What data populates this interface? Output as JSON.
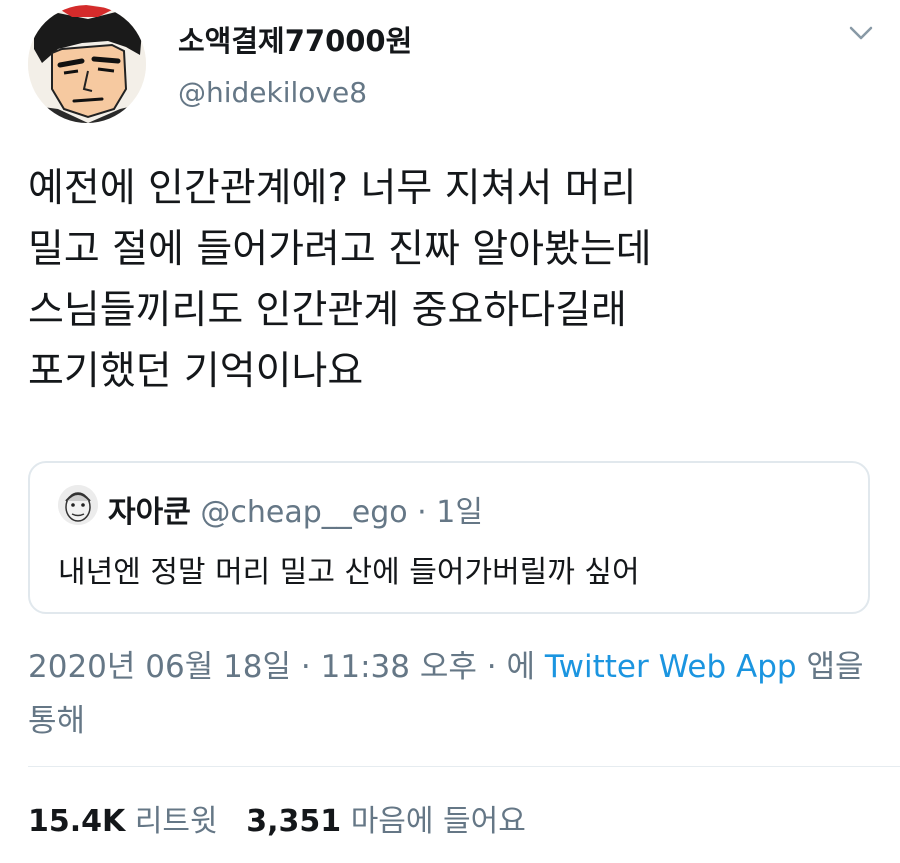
{
  "author": {
    "display_name": "소액결제77000원",
    "handle": "@hidekilove8",
    "avatar_icon": "cartoon-man-avatar-icon"
  },
  "tweet": {
    "lines": [
      "예전에 인간관계에? 너무 지쳐서 머리",
      "밀고 절에 들어가려고 진짜 알아봤는데",
      "스님들끼리도 인간관계 중요하다길래",
      "포기했던 기억이나요"
    ]
  },
  "quoted_tweet": {
    "display_name": "자아쿤",
    "handle": "@cheap__ego",
    "separator": "·",
    "time": "1일",
    "text": "내년엔 정말 머리 밀고 산에 들어가버릴까 싶어",
    "avatar_icon": "cartoon-face-avatar-icon"
  },
  "meta": {
    "date": "2020년 06월 18일",
    "separator": "·",
    "time": "11:38 오후",
    "via_prefix": "에",
    "source_link": "Twitter Web App",
    "via_suffix": "앱을 통해"
  },
  "stats": {
    "retweets_count": "15.4K",
    "retweets_label": "리트윗",
    "likes_count": "3,351",
    "likes_label": "마음에 들어요"
  },
  "colors": {
    "text": "#14171a",
    "secondary": "#657786",
    "link": "#1b95e0",
    "border": "#e1e8ed"
  }
}
